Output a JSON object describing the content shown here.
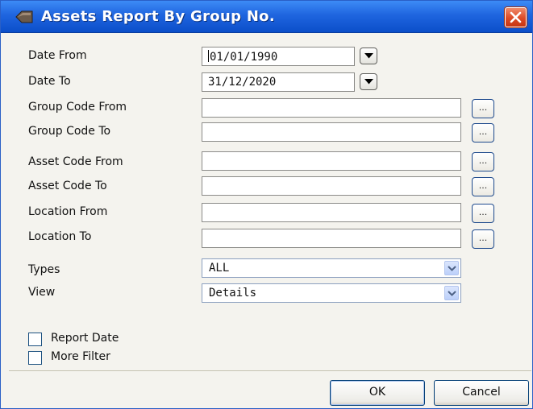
{
  "window": {
    "title": "Assets Report By Group No.",
    "title_icon": "diamond-app-icon",
    "close_icon": "close-icon",
    "colors": {
      "titlebar": "#1f65df",
      "close": "#dd4a26",
      "background": "#f4f3ee"
    }
  },
  "form": {
    "date_from": {
      "label": "Date From",
      "value": "01/01/1990"
    },
    "date_to": {
      "label": "Date To",
      "value": "31/12/2020"
    },
    "group_code_from": {
      "label": "Group Code From",
      "value": ""
    },
    "group_code_to": {
      "label": "Group Code To",
      "value": ""
    },
    "asset_code_from": {
      "label": "Asset Code From",
      "value": ""
    },
    "asset_code_to": {
      "label": "Asset Code To",
      "value": ""
    },
    "location_from": {
      "label": "Location From",
      "value": ""
    },
    "location_to": {
      "label": "Location To",
      "value": ""
    },
    "browse_label": "...",
    "types": {
      "label": "Types",
      "selected": "ALL"
    },
    "view": {
      "label": "View",
      "selected": "Details"
    }
  },
  "options": {
    "report_date": {
      "label": "Report Date",
      "checked": false
    },
    "more_filter": {
      "label": "More Filter",
      "checked": false
    }
  },
  "buttons": {
    "ok": "OK",
    "cancel": "Cancel"
  }
}
